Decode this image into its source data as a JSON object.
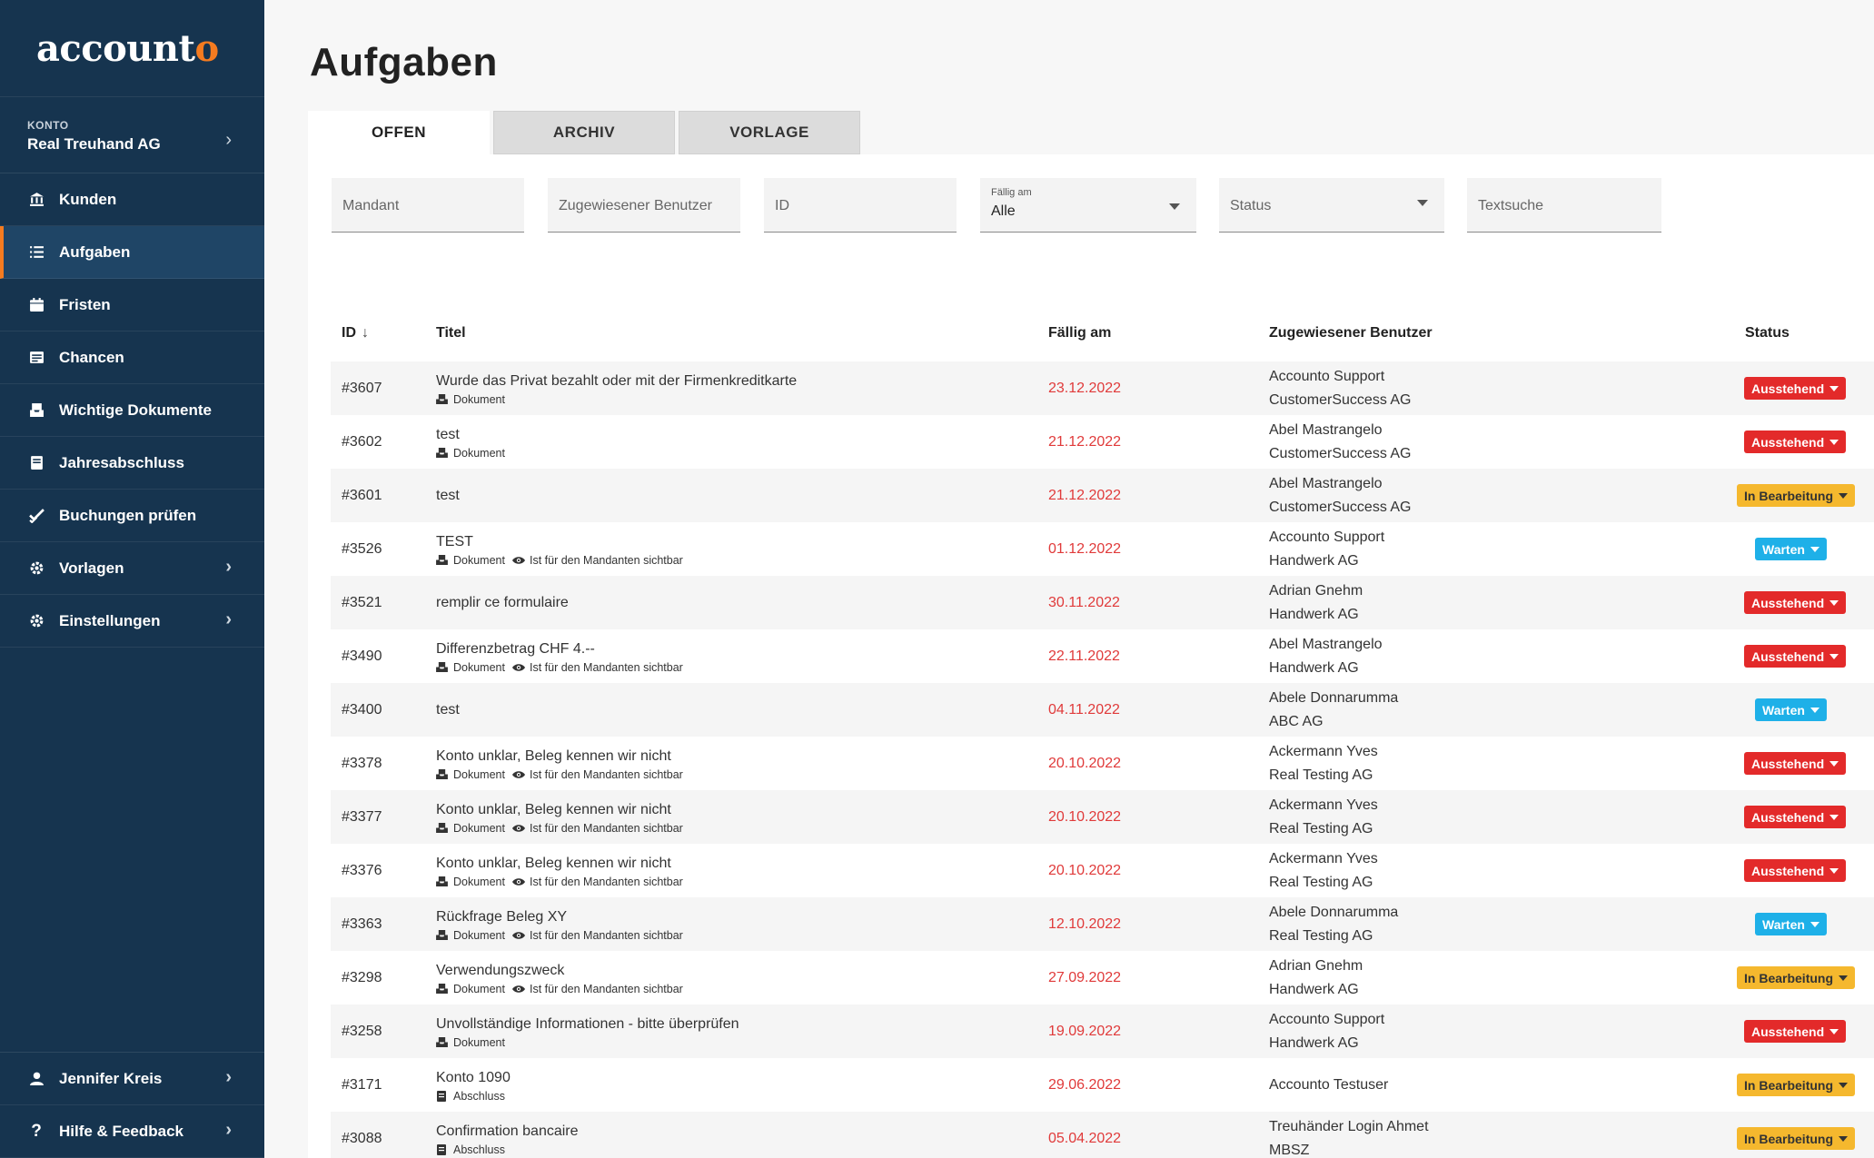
{
  "brand": {
    "logo_main": "account",
    "logo_accent": "o",
    "accent_color": "#f47b20",
    "sidebar_color": "#16344f"
  },
  "konto": {
    "label": "KONTO",
    "value": "Real Treuhand AG"
  },
  "nav": [
    {
      "label": "Kunden",
      "icon": "bank-icon"
    },
    {
      "label": "Aufgaben",
      "icon": "list-icon",
      "active": true
    },
    {
      "label": "Fristen",
      "icon": "calendar-icon"
    },
    {
      "label": "Chancen",
      "icon": "card-icon"
    },
    {
      "label": "Wichtige Dokumente",
      "icon": "inbox-icon"
    },
    {
      "label": "Jahresabschluss",
      "icon": "book-icon"
    },
    {
      "label": "Buchungen prüfen",
      "icon": "check-icon"
    },
    {
      "label": "Vorlagen",
      "icon": "gear-icon",
      "has_children": true
    },
    {
      "label": "Einstellungen",
      "icon": "gear-icon",
      "has_children": true
    }
  ],
  "user_menu": {
    "label": "Jennifer Kreis"
  },
  "help_menu": {
    "label": "Hilfe & Feedback"
  },
  "page": {
    "title": "Aufgaben"
  },
  "tabs": [
    {
      "label": "OFFEN",
      "active": true
    },
    {
      "label": "ARCHIV"
    },
    {
      "label": "VORLAGE"
    }
  ],
  "filters": {
    "mandant": "Mandant",
    "benutzer": "Zugewiesener Benutzer",
    "id": "ID",
    "faellig_label": "Fällig am",
    "faellig_value": "Alle",
    "status": "Status",
    "textsuche": "Textsuche"
  },
  "table": {
    "headers": {
      "id": "ID",
      "title": "Titel",
      "date": "Fällig am",
      "user": "Zugewiesener Benutzer",
      "status": "Status"
    },
    "status_colors": {
      "Ausstehend": "#e32a2a",
      "In Bearbeitung": "#f5b82e",
      "Warten": "#1eb0e8"
    },
    "rows": [
      {
        "id": "#3607",
        "title": "Wurde das Privat bezahlt oder mit der Firmenkreditkarte",
        "type": "Dokument",
        "visible": "",
        "date": "23.12.2022",
        "user": "Accounto Support",
        "company": "CustomerSuccess AG",
        "status": "Ausstehend"
      },
      {
        "id": "#3602",
        "title": "test",
        "type": "Dokument",
        "visible": "",
        "date": "21.12.2022",
        "user": "Abel Mastrangelo",
        "company": "CustomerSuccess AG",
        "status": "Ausstehend"
      },
      {
        "id": "#3601",
        "title": "test",
        "type": "",
        "visible": "",
        "date": "21.12.2022",
        "user": "Abel Mastrangelo",
        "company": "CustomerSuccess AG",
        "status": "In Bearbeitung"
      },
      {
        "id": "#3526",
        "title": "TEST",
        "type": "Dokument",
        "visible": "Ist für den Mandanten sichtbar",
        "date": "01.12.2022",
        "user": "Accounto Support",
        "company": "Handwerk AG",
        "status": "Warten"
      },
      {
        "id": "#3521",
        "title": "remplir ce formulaire",
        "type": "",
        "visible": "",
        "date": "30.11.2022",
        "user": "Adrian Gnehm",
        "company": "Handwerk AG",
        "status": "Ausstehend"
      },
      {
        "id": "#3490",
        "title": "Differenzbetrag CHF 4.--",
        "type": "Dokument",
        "visible": "Ist für den Mandanten sichtbar",
        "date": "22.11.2022",
        "user": "Abel Mastrangelo",
        "company": "Handwerk AG",
        "status": "Ausstehend"
      },
      {
        "id": "#3400",
        "title": "test",
        "type": "",
        "visible": "",
        "date": "04.11.2022",
        "user": "Abele Donnarumma",
        "company": "ABC AG",
        "status": "Warten"
      },
      {
        "id": "#3378",
        "title": "Konto unklar, Beleg kennen wir nicht",
        "type": "Dokument",
        "visible": "Ist für den Mandanten sichtbar",
        "date": "20.10.2022",
        "user": "Ackermann Yves",
        "company": "Real Testing AG",
        "status": "Ausstehend"
      },
      {
        "id": "#3377",
        "title": "Konto unklar, Beleg kennen wir nicht",
        "type": "Dokument",
        "visible": "Ist für den Mandanten sichtbar",
        "date": "20.10.2022",
        "user": "Ackermann Yves",
        "company": "Real Testing AG",
        "status": "Ausstehend"
      },
      {
        "id": "#3376",
        "title": "Konto unklar, Beleg kennen wir nicht",
        "type": "Dokument",
        "visible": "Ist für den Mandanten sichtbar",
        "date": "20.10.2022",
        "user": "Ackermann Yves",
        "company": "Real Testing AG",
        "status": "Ausstehend"
      },
      {
        "id": "#3363",
        "title": "Rückfrage Beleg XY",
        "type": "Dokument",
        "visible": "Ist für den Mandanten sichtbar",
        "date": "12.10.2022",
        "user": "Abele Donnarumma",
        "company": "Real Testing AG",
        "status": "Warten"
      },
      {
        "id": "#3298",
        "title": "Verwendungszweck",
        "type": "Dokument",
        "visible": "Ist für den Mandanten sichtbar",
        "date": "27.09.2022",
        "user": "Adrian Gnehm",
        "company": "Handwerk AG",
        "status": "In Bearbeitung"
      },
      {
        "id": "#3258",
        "title": "Unvollständige Informationen - bitte überprüfen",
        "type": "Dokument",
        "visible": "",
        "date": "19.09.2022",
        "user": "Accounto Support",
        "company": "Handwerk AG",
        "status": "Ausstehend"
      },
      {
        "id": "#3171",
        "title": "Konto 1090",
        "type": "Abschluss",
        "visible": "",
        "date": "29.06.2022",
        "user": "Accounto Testuser",
        "company": "",
        "status": "In Bearbeitung"
      },
      {
        "id": "#3088",
        "title": "Confirmation bancaire",
        "type": "Abschluss",
        "visible": "",
        "date": "05.04.2022",
        "user": "Treuhänder Login Ahmet",
        "company": "MBSZ",
        "status": "In Bearbeitung"
      }
    ]
  }
}
